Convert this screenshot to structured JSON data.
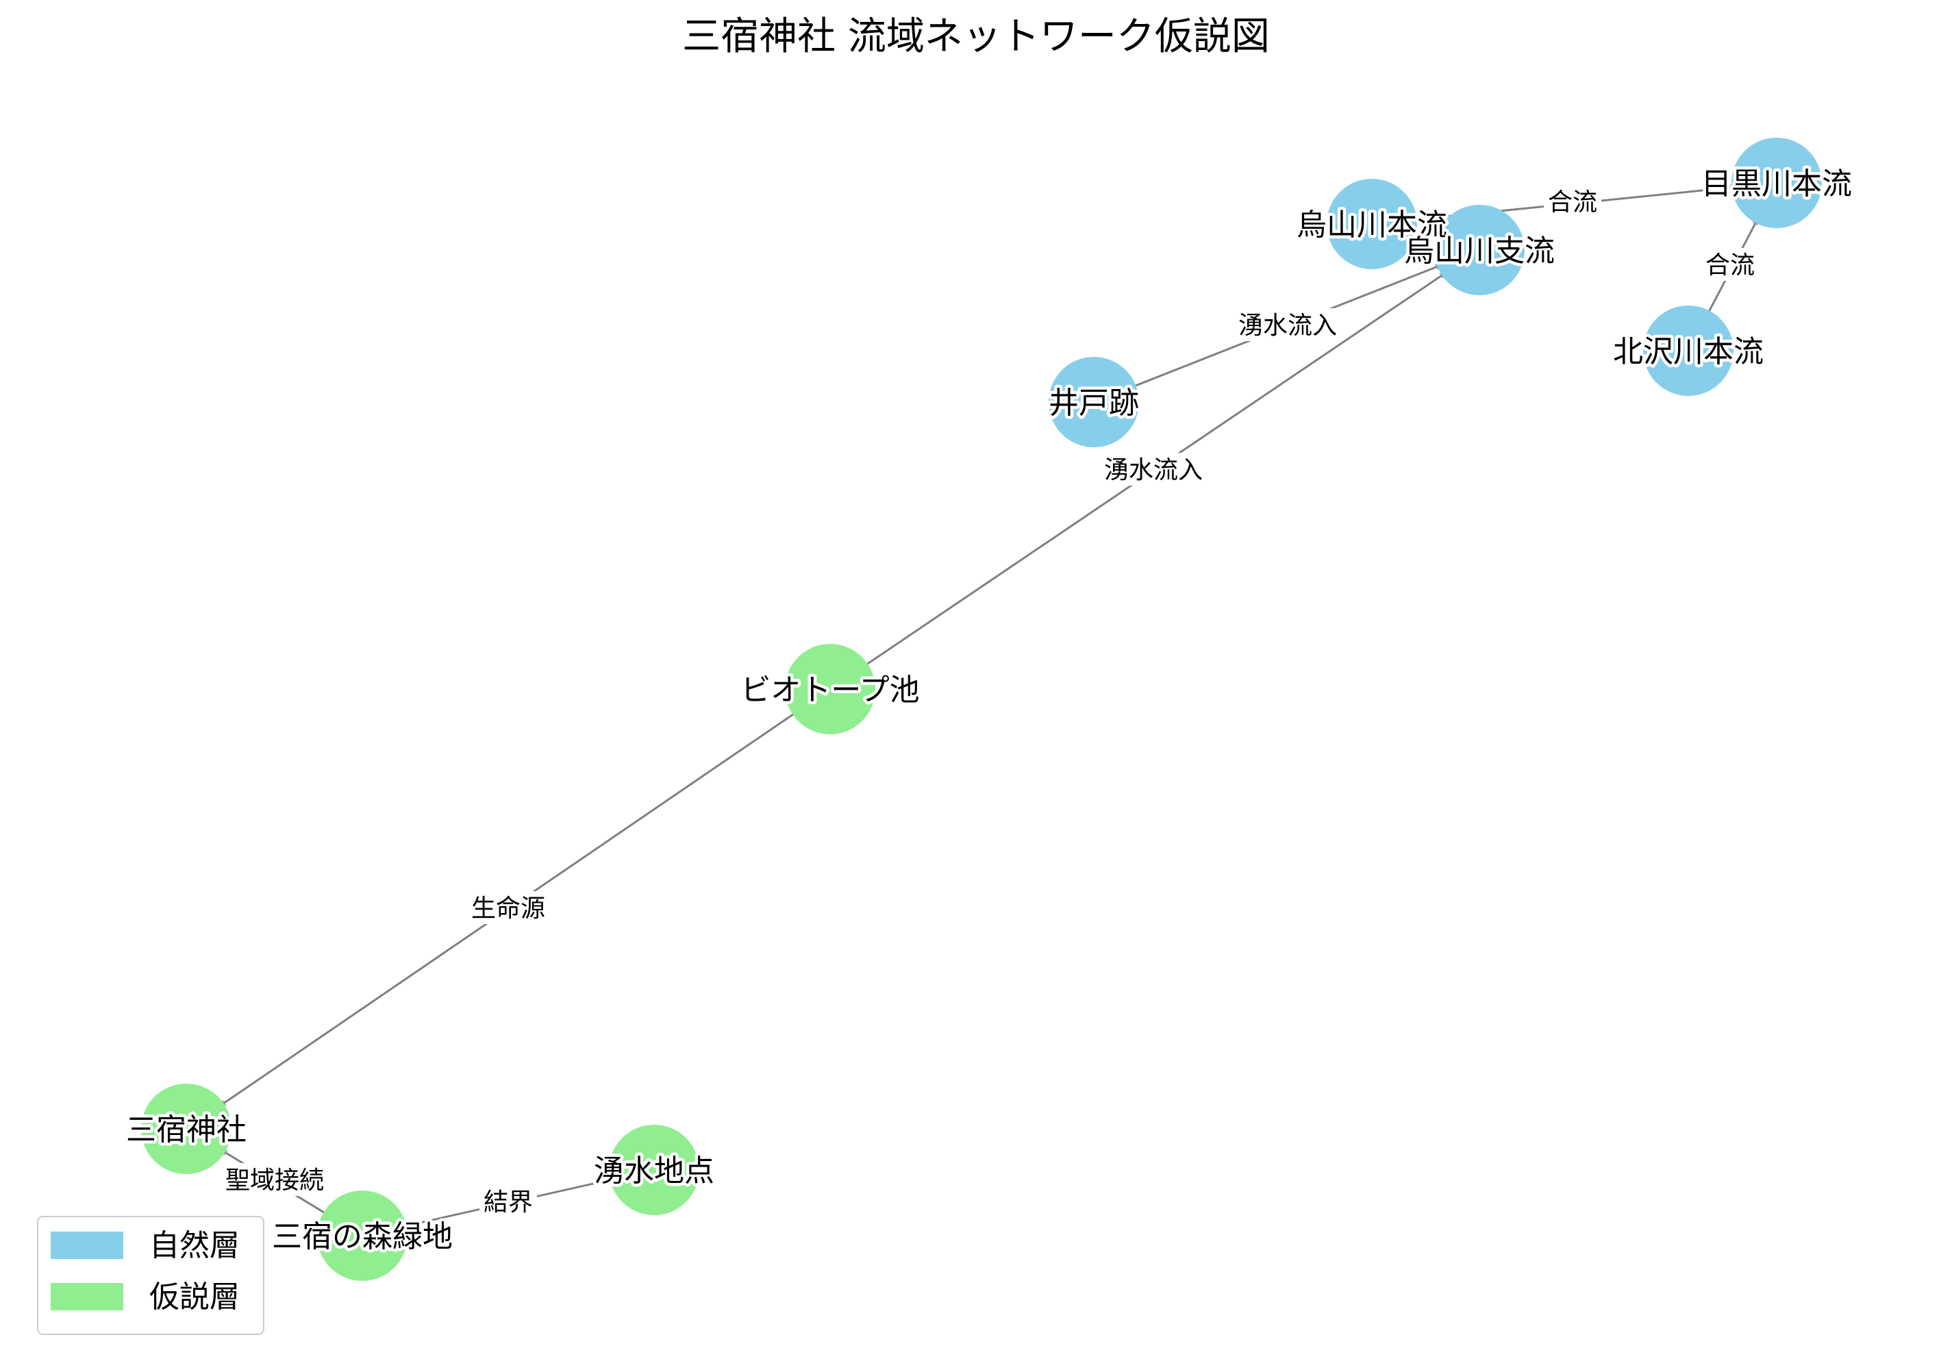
{
  "title": "三宿神社 流域ネットワーク仮説図",
  "colors": {
    "natural": "#87ceeb",
    "hypothesis": "#90ee90",
    "edge": "#808080"
  },
  "legend": [
    {
      "label": "自然層",
      "color": "#87ceeb"
    },
    {
      "label": "仮説層",
      "color": "#90ee90"
    }
  ],
  "nodes": [
    {
      "id": "meguro",
      "label": "目黒川本流",
      "layer": "自然層"
    },
    {
      "id": "karasu_main",
      "label": "烏山川本流",
      "layer": "自然層"
    },
    {
      "id": "karasu_branch",
      "label": "烏山川支流",
      "layer": "自然層"
    },
    {
      "id": "kitazawa",
      "label": "北沢川本流",
      "layer": "自然層"
    },
    {
      "id": "ido",
      "label": "井戸跡",
      "layer": "自然層"
    },
    {
      "id": "biotope",
      "label": "ビオトープ池",
      "layer": "仮説層"
    },
    {
      "id": "shrine",
      "label": "三宿神社",
      "layer": "仮説層"
    },
    {
      "id": "forest",
      "label": "三宿の森緑地",
      "layer": "仮説層"
    },
    {
      "id": "spring",
      "label": "湧水地点",
      "layer": "仮説層"
    }
  ],
  "edges": [
    {
      "from": "karasu_main",
      "to": "meguro",
      "label": "合流"
    },
    {
      "from": "kitazawa",
      "to": "meguro",
      "label": "合流"
    },
    {
      "from": "ido",
      "to": "karasu_branch",
      "label": "湧水流入"
    },
    {
      "from": "biotope",
      "to": "karasu_branch",
      "label": "湧水流入"
    },
    {
      "from": "biotope",
      "to": "shrine",
      "label": "生命源"
    },
    {
      "from": "forest",
      "to": "shrine",
      "label": "聖域接続"
    },
    {
      "from": "spring",
      "to": "forest",
      "label": "結界"
    }
  ]
}
